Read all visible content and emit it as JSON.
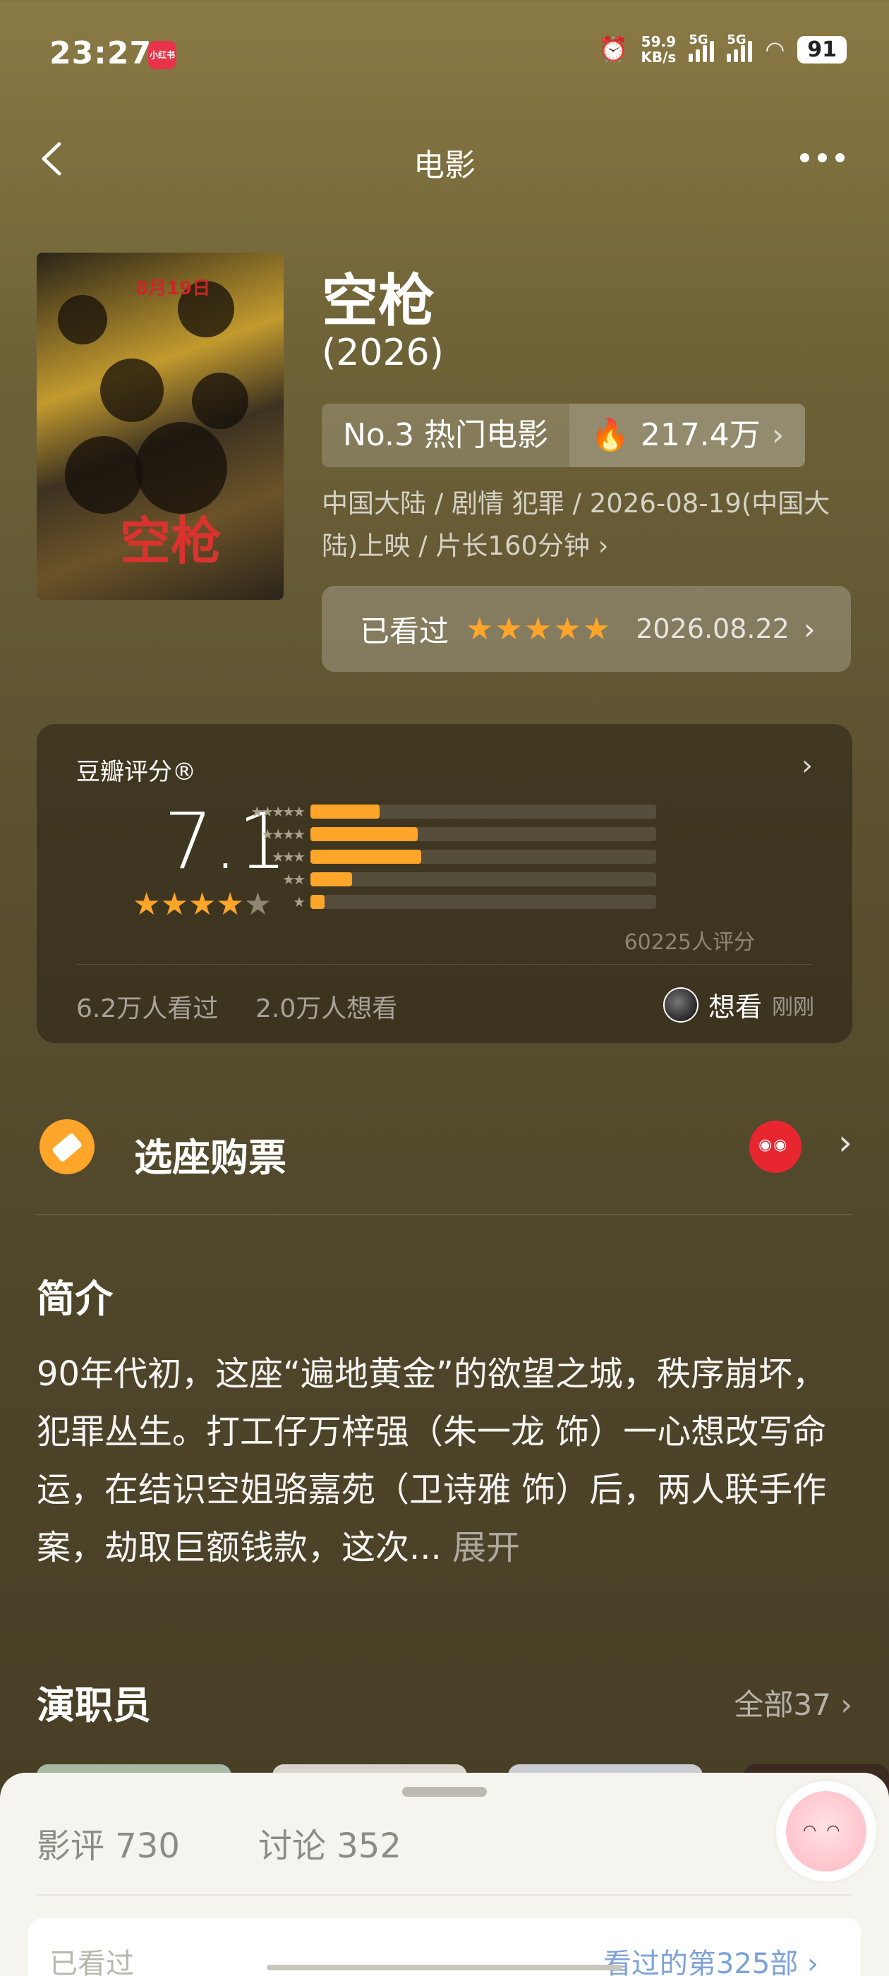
{
  "status": {
    "time": "23:27",
    "app_badge": "小红书",
    "net_speed_value": "59.9",
    "net_speed_unit": "KB/s",
    "sim1": "5G",
    "sim2": "5G",
    "battery": "91"
  },
  "nav": {
    "title": "电影"
  },
  "movie": {
    "poster_date": "8月19日",
    "poster_title": "空枪",
    "title": "空枪",
    "year": "(2026)",
    "rank": "No.3 热门电影",
    "heat": "217.4万",
    "meta_line": "中国大陆 / 剧情 犯罪 / 2026-08-19(中国大陆)上映 / 片长160分钟 ›",
    "seen_label": "已看过",
    "my_stars": "★★★★★",
    "seen_date": "2026.08.22"
  },
  "rating": {
    "title": "豆瓣评分®",
    "score": "7.1",
    "star_labels": [
      "★★★★★",
      "★★★★",
      "★★★",
      "★★",
      "★"
    ],
    "distribution": [
      0.2,
      0.31,
      0.32,
      0.12,
      0.04
    ],
    "count": "60225人评分",
    "watched": "6.2万人看过",
    "want": "2.0万人想看",
    "user_action": "想看",
    "user_time": "刚刚"
  },
  "ticket": {
    "label": "选座购票"
  },
  "intro": {
    "title": "简介",
    "text": "90年代初，这座“遍地黄金”的欲望之城，秩序崩坏，犯罪丛生。打工仔万梓强（朱一龙 饰）一心想改写命运，在结识空姐骆嘉苑（卫诗雅 饰）后，两人联手作案，劫取巨额钱款，这次...",
    "expand": "展开"
  },
  "cast": {
    "title": "演职员",
    "all": "全部37 ›"
  },
  "sheet": {
    "review_tab": "影评 730",
    "discuss_tab": "讨论 352",
    "seen_label": "已看过",
    "seen_count": "看过的第325部 ›"
  },
  "colors": {
    "accent": "#ffa52a",
    "background": "#5c5231"
  }
}
